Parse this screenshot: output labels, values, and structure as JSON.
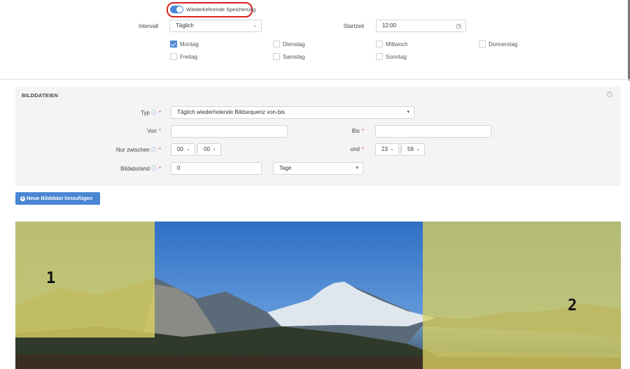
{
  "toggle": {
    "label": "Wiederkehrende Speicherung",
    "on": true
  },
  "schedule": {
    "interval_label": "Intervall",
    "interval_value": "Täglich",
    "start_label": "Startzeit",
    "start_value": "12:00"
  },
  "days": [
    {
      "label": "Montag",
      "checked": true
    },
    {
      "label": "Dienstag",
      "checked": false
    },
    {
      "label": "Mittwoch",
      "checked": false
    },
    {
      "label": "Donnerstag",
      "checked": false
    },
    {
      "label": "Freitag",
      "checked": false
    },
    {
      "label": "Samstag",
      "checked": false
    },
    {
      "label": "Sonntag",
      "checked": false
    }
  ],
  "images_section": {
    "title": "BILDDATEIEN",
    "typ_label": "Typ",
    "typ_value": "Täglich wiederholende Bildsequenz von-bis",
    "von_label": "Von",
    "von_value": "",
    "bis_label": "Bis",
    "bis_value": "",
    "nur_label": "Nur zwischen",
    "nur_hour": "00",
    "nur_min": "00",
    "und_label": "und",
    "und_hour": "23",
    "und_min": "59",
    "abstand_label": "Bildabstand",
    "abstand_value": "0",
    "abstand_unit": "Tage"
  },
  "add_button": "Neue Bilddatei hinzufügen",
  "overlays": {
    "left_number": "1",
    "right_number": "2"
  },
  "colors": {
    "accent": "#4a86d4",
    "highlight_ring": "#d9231c",
    "overlay": "#d8d060",
    "section_bg": "#f4f4f4"
  }
}
